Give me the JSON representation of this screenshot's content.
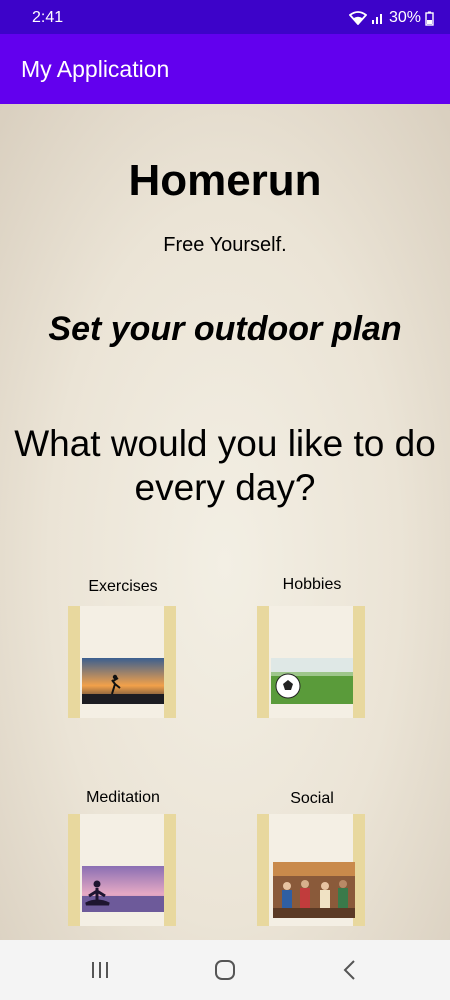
{
  "status_bar": {
    "time": "2:41",
    "battery": "30%"
  },
  "app_bar": {
    "title": "My Application"
  },
  "main": {
    "title": "Homerun",
    "subtitle": "Free Yourself.",
    "plan_heading": "Set your outdoor plan",
    "question": "What would you like to do every day?"
  },
  "tiles": [
    {
      "label": "Exercises"
    },
    {
      "label": "Hobbies"
    },
    {
      "label": "Meditation"
    },
    {
      "label": "Social"
    }
  ],
  "nav": {
    "icons": [
      "recent-apps-icon",
      "home-icon",
      "back-icon"
    ]
  },
  "colors": {
    "status_bar": "#3d03c9",
    "app_bar": "#6200ee",
    "tile_frame": "#e8d89e"
  }
}
